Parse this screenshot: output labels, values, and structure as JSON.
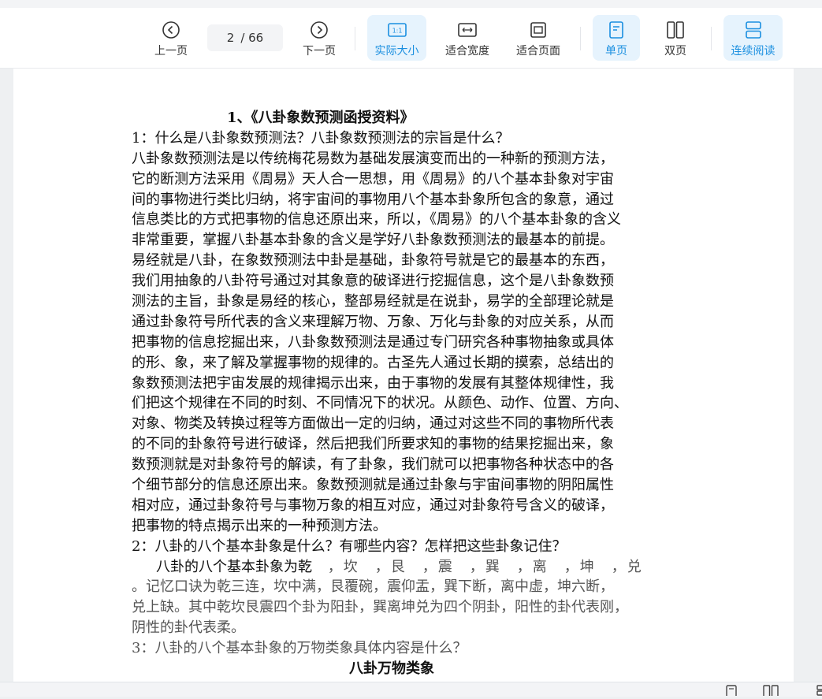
{
  "toolbar": {
    "prev_label": "上一页",
    "next_label": "下一页",
    "current_page": "2",
    "total_pages": "/ 66",
    "actual_size_label": "实际大小",
    "actual_size_icon_text": "1:1",
    "fit_width_label": "适合宽度",
    "fit_page_label": "适合页面",
    "single_page_label": "单页",
    "double_page_label": "双页",
    "continuous_label": "连续阅读",
    "active_color": "#1a8fe0"
  },
  "document": {
    "title": "1、《八卦象数预测函授资料》",
    "lines": [
      "1：什么是八卦象数预测法？八卦象数预测法的宗旨是什么？",
      "八卦象数预测法是以传统梅花易数为基础发展演变而出的一种新的预测方法，",
      "它的断测方法采用《周易》天人合一思想，用《周易》的八个基本卦象对宇宙",
      "间的事物进行类比归纳，将宇宙间的事物用八个基本卦象所包含的象意，通过",
      "信息类比的方式把事物的信息还原出来，所以，《周易》的八个基本卦象的含义",
      "非常重要，掌握八卦基本卦象的含义是学好八卦象数预测法的最基本的前提。",
      "易经就是八卦，在象数预测法中卦是基础，卦象符号就是它的最基本的东西，",
      "我们用抽象的八卦符号通过对其象意的破译进行挖掘信息，这个是八卦象数预",
      "测法的主旨，卦象是易经的核心，整部易经就是在说卦，易学的全部理论就是",
      "通过卦象符号所代表的含义来理解万物、万象、万化与卦象的对应关系，从而",
      "把事物的信息挖掘出来，八卦象数预测法是通过专门研究各种事物抽象或具体",
      "的形、象，来了解及掌握事物的规律的。古圣先人通过长期的摸索，总结出的",
      "象数预测法把宇宙发展的规律揭示出来，由于事物的发展有其整体规律性，我",
      "们把这个规律在不同的时刻、不同情况下的状况。从颜色、动作、位置、方向、",
      "对象、物类及转换过程等方面做出一定的归纳，通过对这些不同的事物所代表",
      "的不同的卦象符号进行破译，然后把我们所要求知的事物的结果挖掘出来，象",
      "数预测就是对卦象符号的解读，有了卦象，我们就可以把事物各种状态中的各",
      "个细节部分的信息还原出来。象数预测就是通过卦象与宇宙间事物的阴阳属性",
      "相对应，通过卦象符号与事物万象的相互对应，通过对卦象符号含义的破译，",
      "把事物的特点揭示出来的一种预测方法。"
    ],
    "q2": "2：八卦的八个基本卦象是什么？有哪些内容？怎样把这些卦象记住？",
    "q2_intro": "八卦的八个基本卦象为乾",
    "q2_trigrams": "，坎　，艮　，震　，巽　，离　，坤　，兑",
    "q2_memo": "。记忆口诀为乾三连，坎中满，艮覆碗，震仰盂，巽下断，离中虚，坤六断，",
    "q2_memo2": "兑上缺。其中乾坎艮震四个卦为阳卦，巽离坤兑为四个阴卦，阳性的卦代表刚，",
    "q2_memo3": "阴性的卦代表柔。",
    "q3": "3：八卦的八个基本卦象的万物类象具体内容是什么？",
    "section_title": "八卦万物类象"
  }
}
